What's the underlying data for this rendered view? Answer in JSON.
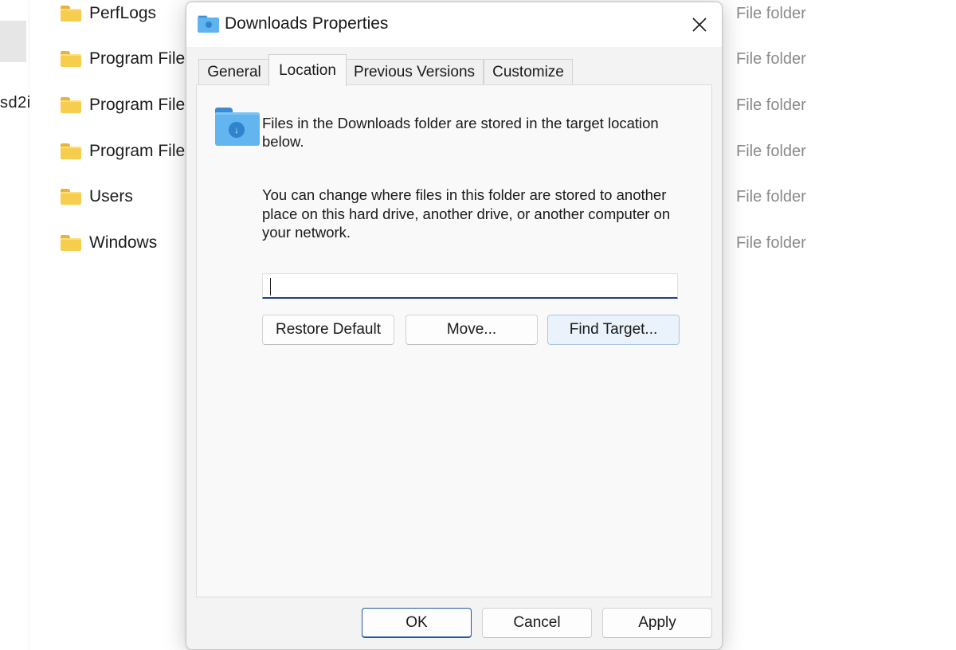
{
  "explorer": {
    "left_fragment": "sd2i",
    "rows": [
      {
        "name": "PerfLogs",
        "type": "File folder"
      },
      {
        "name": "Program File",
        "type": "File folder"
      },
      {
        "name": "Program File",
        "type": "File folder"
      },
      {
        "name": "Program File",
        "type": "File folder"
      },
      {
        "name": "Users",
        "type": "File folder"
      },
      {
        "name": "Windows",
        "type": "File folder"
      }
    ],
    "folder_icon": "folder-icon"
  },
  "dialog": {
    "title": "Downloads Properties",
    "title_icon": "downloads-folder-icon",
    "close_icon": "close-icon",
    "tabs": [
      {
        "label": "General",
        "active": false
      },
      {
        "label": "Location",
        "active": true
      },
      {
        "label": "Previous Versions",
        "active": false
      },
      {
        "label": "Customize",
        "active": false
      }
    ],
    "location": {
      "folder_icon": "downloads-folder-icon",
      "info": "Files in the Downloads folder are stored in the target location below.",
      "description": "You can change where files in this folder are stored to another place on this hard drive, another drive, or another computer on your network.",
      "path_value": "",
      "restore_default_label": "Restore Default",
      "move_label": "Move...",
      "find_target_label": "Find Target..."
    },
    "footer": {
      "ok_label": "OK",
      "cancel_label": "Cancel",
      "apply_label": "Apply"
    }
  },
  "colors": {
    "accent_border": "#1f5aa8",
    "folder_yellow": "#f7cd4e",
    "folder_blue": "#62b5ef"
  }
}
